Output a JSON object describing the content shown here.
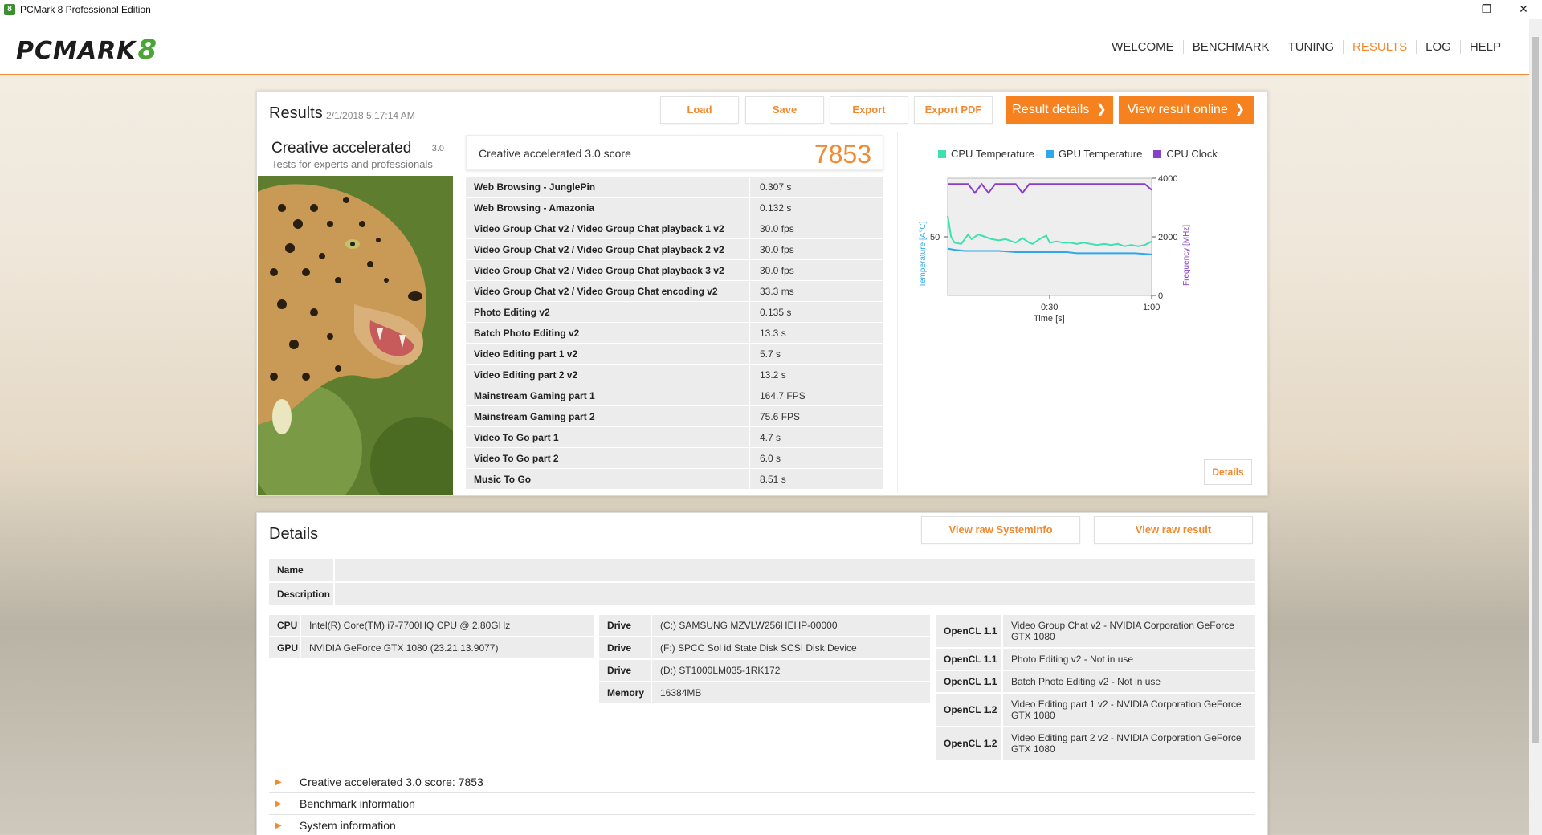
{
  "window": {
    "title": "PCMark 8 Professional Edition",
    "app_icon": "8"
  },
  "header": {
    "logo_text": "PCMARK",
    "logo_mark": "8",
    "nav": [
      {
        "label": "WELCOME"
      },
      {
        "label": "BENCHMARK"
      },
      {
        "label": "TUNING"
      },
      {
        "label": "RESULTS"
      },
      {
        "label": "LOG"
      },
      {
        "label": "HELP"
      }
    ],
    "active": "RESULTS"
  },
  "results": {
    "title": "Results",
    "date": "2/1/2018 5:17:14 AM",
    "buttons": {
      "load": "Load",
      "save": "Save",
      "export": "Export",
      "export_pdf": "Export PDF",
      "result_details": "Result details",
      "view_online": "View result online"
    },
    "benchmark": {
      "name": "Creative accelerated",
      "version": "3.0",
      "subtitle": "Tests for experts and professionals"
    },
    "score_label": "Creative accelerated 3.0 score",
    "score": "7853",
    "rows": [
      {
        "name": "Web Browsing - JunglePin",
        "value": "0.307 s"
      },
      {
        "name": "Web Browsing - Amazonia",
        "value": "0.132 s"
      },
      {
        "name": "Video Group Chat v2 / Video Group Chat playback 1 v2",
        "value": "30.0 fps"
      },
      {
        "name": "Video Group Chat v2 / Video Group Chat playback 2 v2",
        "value": "30.0 fps"
      },
      {
        "name": "Video Group Chat v2 / Video Group Chat playback 3 v2",
        "value": "30.0 fps"
      },
      {
        "name": "Video Group Chat v2 / Video Group Chat encoding v2",
        "value": "33.3 ms"
      },
      {
        "name": "Photo Editing v2",
        "value": "0.135 s"
      },
      {
        "name": "Batch Photo Editing v2",
        "value": "13.3 s"
      },
      {
        "name": "Video Editing part 1 v2",
        "value": "5.7 s"
      },
      {
        "name": "Video Editing part 2 v2",
        "value": "13.2 s"
      },
      {
        "name": "Mainstream Gaming part 1",
        "value": "164.7 FPS"
      },
      {
        "name": "Mainstream Gaming part 2",
        "value": "75.6 FPS"
      },
      {
        "name": "Video To Go part 1",
        "value": "4.7 s"
      },
      {
        "name": "Video To Go part 2",
        "value": "6.0 s"
      },
      {
        "name": "Music To Go",
        "value": "8.51 s"
      }
    ],
    "details_button": "Details"
  },
  "chart_data": {
    "type": "line",
    "legend": [
      {
        "name": "CPU Temperature",
        "color": "#3ee0b0"
      },
      {
        "name": "GPU Temperature",
        "color": "#2ea8e8"
      },
      {
        "name": "CPU Clock",
        "color": "#8a3fc8"
      }
    ],
    "xlabel": "Time [s]",
    "ylabel_left": "Temperature [A°C]",
    "ylabel_right": "Frequency [MHz]",
    "x_ticks": [
      "0:30",
      "1:00"
    ],
    "y_left_ticks": [
      "50"
    ],
    "y_right_ticks": [
      "4000",
      "2000",
      "0"
    ],
    "xlim": [
      0,
      60
    ],
    "ylim_left": [
      0,
      100
    ],
    "ylim_right": [
      0,
      4000
    ],
    "series": [
      {
        "name": "CPU Temperature",
        "axis": "left",
        "x": [
          0,
          1,
          2,
          4,
          6,
          7,
          9,
          10,
          12,
          13,
          15,
          17,
          19,
          20,
          22,
          24,
          25,
          27,
          29,
          30,
          32,
          34,
          36,
          38,
          40,
          42,
          44,
          46,
          48,
          50,
          52,
          54,
          56,
          58,
          60
        ],
        "y": [
          68,
          50,
          45,
          44,
          52,
          48,
          52,
          51,
          49,
          48,
          47,
          48,
          46,
          45,
          49,
          45,
          44,
          48,
          51,
          45,
          46,
          45,
          45,
          44,
          45,
          44,
          43,
          44,
          43,
          44,
          42,
          43,
          42,
          43,
          46
        ]
      },
      {
        "name": "GPU Temperature",
        "axis": "left",
        "x": [
          0,
          2,
          5,
          10,
          15,
          20,
          25,
          30,
          35,
          38,
          40,
          45,
          50,
          55,
          60
        ],
        "y": [
          40,
          39,
          38,
          38,
          38,
          37,
          37,
          37,
          37,
          36,
          36,
          36,
          36,
          36,
          35
        ]
      },
      {
        "name": "CPU Clock",
        "axis": "right",
        "x": [
          0,
          3,
          6,
          8,
          10,
          12,
          14,
          18,
          20,
          22,
          24,
          26,
          30,
          32,
          36,
          38,
          42,
          45,
          50,
          55,
          58,
          60
        ],
        "y": [
          3800,
          3800,
          3800,
          3500,
          3800,
          3500,
          3800,
          3800,
          3800,
          3500,
          3800,
          3800,
          3800,
          3800,
          3800,
          3800,
          3800,
          3800,
          3800,
          3800,
          3800,
          3600
        ]
      }
    ]
  },
  "details": {
    "title": "Details",
    "buttons": {
      "raw_systeminfo": "View raw SystemInfo",
      "raw_result": "View raw result"
    },
    "name_label": "Name",
    "name_value": "",
    "description_label": "Description",
    "description_value": "",
    "hardware": [
      {
        "key": "CPU",
        "value": "Intel(R) Core(TM) i7-7700HQ CPU @ 2.80GHz"
      },
      {
        "key": "GPU",
        "value": "NVIDIA GeForce GTX 1080 (23.21.13.9077)"
      }
    ],
    "storage": [
      {
        "key": "Drive",
        "value": "(C:) SAMSUNG MZVLW256HEHP-00000"
      },
      {
        "key": "Drive",
        "value": "(F:) SPCC Sol id State Disk SCSI Disk Device"
      },
      {
        "key": "Drive",
        "value": "(D:) ST1000LM035-1RK172"
      },
      {
        "key": "Memory",
        "value": "16384MB"
      }
    ],
    "opencl": [
      {
        "key": "OpenCL 1.1",
        "value": "Video Group Chat v2 - NVIDIA Corporation GeForce GTX 1080"
      },
      {
        "key": "OpenCL 1.1",
        "value": "Photo Editing v2 - Not in use"
      },
      {
        "key": "OpenCL 1.1",
        "value": "Batch Photo Editing v2 - Not in use"
      },
      {
        "key": "OpenCL 1.2",
        "value": "Video Editing part 1 v2 - NVIDIA Corporation GeForce GTX 1080"
      },
      {
        "key": "OpenCL 1.2",
        "value": "Video Editing part 2 v2 - NVIDIA Corporation GeForce GTX 1080"
      }
    ],
    "expanders": [
      {
        "label": "Creative accelerated 3.0 score: 7853"
      },
      {
        "label": "Benchmark information"
      },
      {
        "label": "System information"
      }
    ]
  }
}
